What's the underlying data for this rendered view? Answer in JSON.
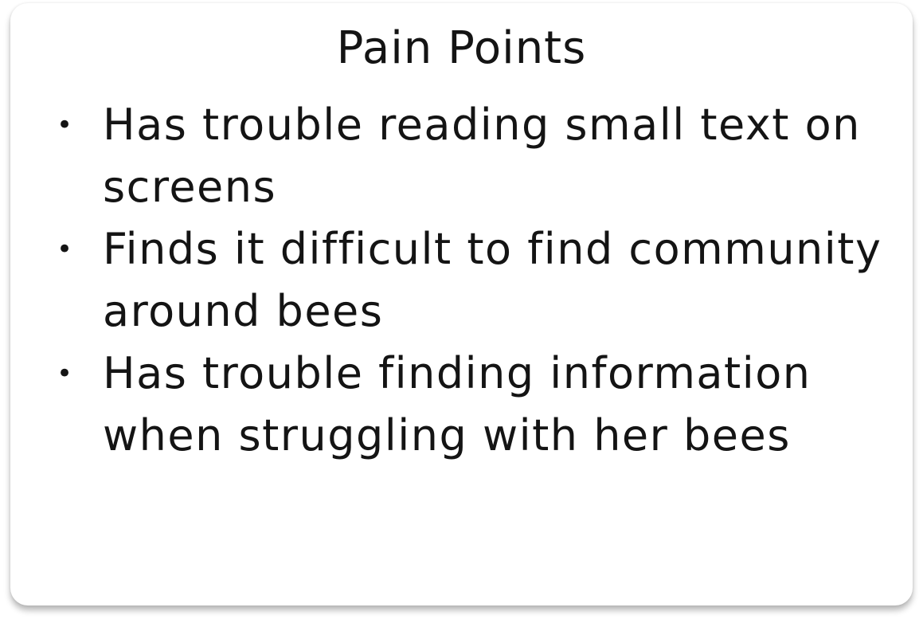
{
  "card": {
    "title": "Pain Points",
    "bullet_glyph": "•",
    "items": [
      {
        "text": "Has trouble reading small text on screens"
      },
      {
        "text": "Finds it difficult to find community around bees"
      },
      {
        "text": "Has trouble finding information when struggling with her bees"
      }
    ]
  }
}
